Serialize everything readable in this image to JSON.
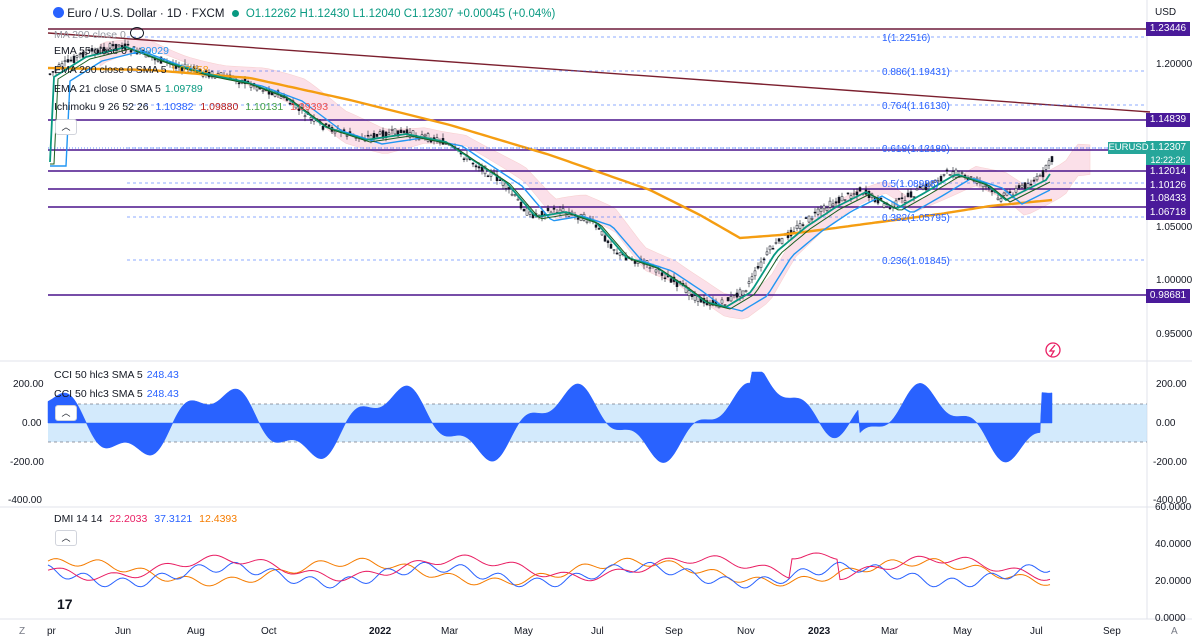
{
  "header": {
    "symbol": "Euro / U.S. Dollar · 1D · FXCM",
    "ohlc": "O1.12262 H1.12430 L1.12040 C1.12307 +0.00045 (+0.04%)",
    "currency": "USD"
  },
  "legend": {
    "ma200": "MA 200 close 0",
    "ema55": "EMA 55 close 0",
    "ema55_val": "1.09029",
    "ema200": "EMA 200 close 0 SMA 5",
    "ema200_val": "1.07458",
    "ema21": "EMA 21 close 0 SMA 5",
    "ema21_val": "1.09789",
    "ichimoku": "Ichimoku 9 26 52 26",
    "ichi_vals": [
      "1.10382",
      "1.09880",
      "1.10131",
      "1.09393"
    ],
    "cci1": "CCI 50 hlc3 SMA 5",
    "cci1_val": "248.43",
    "cci2": "CCI 50 hlc3 SMA 5",
    "cci2_val": "248.43",
    "dmi": "DMI 14 14",
    "dmi_vals": [
      "22.2033",
      "37.3121",
      "12.4393"
    ]
  },
  "fib_levels": [
    {
      "label": "1(1.22516)"
    },
    {
      "label": "0.886(1.19431)"
    },
    {
      "label": "0.764(1.16130)"
    },
    {
      "label": "0.618(1.12180)"
    },
    {
      "label": "0.5(1.08988)"
    },
    {
      "label": "0.382(1.05795)"
    },
    {
      "label": "0.236(1.01845)"
    }
  ],
  "price_axis": [
    "1.20000",
    "1.05000",
    "1.00000",
    "0.95000"
  ],
  "price_tags": [
    "1.23446",
    "1.14839",
    "1.12307",
    "12:22:26",
    "1.12014",
    "1.10126",
    "1.08433",
    "1.06718",
    "0.98681"
  ],
  "symbol_tag": "EURUSD",
  "cci_axis": [
    "200.00",
    "0.00",
    "-200.00",
    "-400.00"
  ],
  "cci_axis_right": [
    "200.00",
    "0.00",
    "-200.00",
    "-400.00"
  ],
  "dmi_axis": [
    "60.0000",
    "40.0000",
    "20.0000",
    "0.0000"
  ],
  "time_axis": [
    "pr",
    "Jun",
    "Aug",
    "Oct",
    "2022",
    "Mar",
    "May",
    "Jul",
    "Sep",
    "Nov",
    "2023",
    "Mar",
    "May",
    "Jul",
    "Sep"
  ],
  "footer": {
    "z": "Z",
    "a": "A"
  },
  "colors": {
    "purple_line": "#4a148c",
    "fib": "#2962ff",
    "ema200": "#f59d11",
    "ema55": "#2196f3",
    "ema21": "#089981",
    "cci_fill": "#2962ff",
    "dmi_adx": "#f57c00",
    "dmi_plus": "#2962ff",
    "dmi_minus": "#e91e63"
  }
}
